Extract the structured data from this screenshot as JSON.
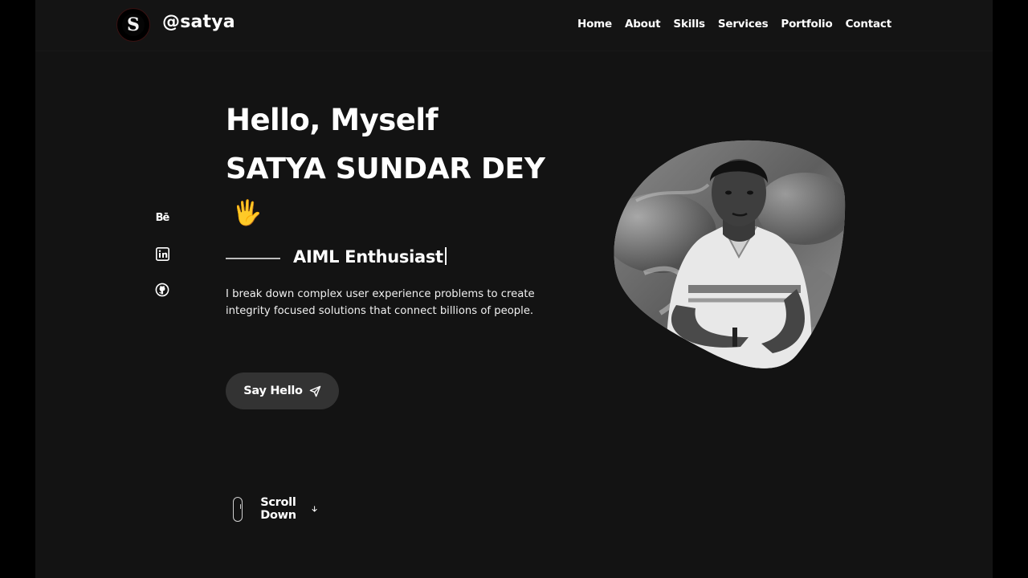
{
  "header": {
    "logo_letter": "S",
    "brand": "@satya",
    "nav": [
      {
        "label": "Home"
      },
      {
        "label": "About"
      },
      {
        "label": "Skills"
      },
      {
        "label": "Services"
      },
      {
        "label": "Portfolio"
      },
      {
        "label": "Contact"
      }
    ]
  },
  "socials": [
    {
      "label": "Bē",
      "icon": "behance-icon"
    },
    {
      "icon": "linkedin-icon"
    },
    {
      "icon": "github-icon"
    }
  ],
  "hero": {
    "greeting": "Hello, Myself",
    "name": "SATYA SUNDAR DEY",
    "wave_emoji": "🖐",
    "role": "AIML Enthusiast",
    "description": "I break down complex user experience problems to create integrity focused solutions that connect billions of people.",
    "cta_label": "Say Hello",
    "scroll_label": "Scroll Down"
  },
  "colors": {
    "background": "#131313",
    "outer": "#000000",
    "button": "#333333",
    "text": "#ffffff"
  }
}
